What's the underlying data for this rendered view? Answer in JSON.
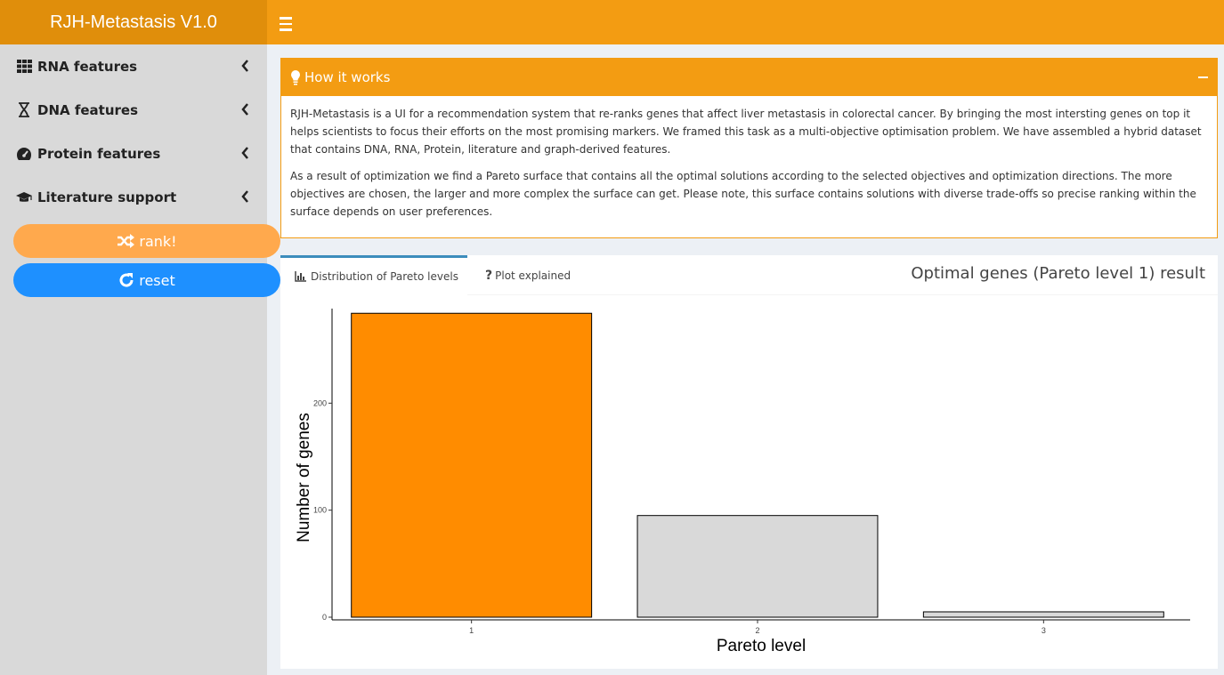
{
  "header": {
    "app_title": "RJH-Metastasis V1.0",
    "menu_icon": "hamburger-icon"
  },
  "sidebar": {
    "items": [
      {
        "label": "RNA features",
        "icon": "grid-icon"
      },
      {
        "label": "DNA features",
        "icon": "hourglass-icon"
      },
      {
        "label": "Protein features",
        "icon": "tachometer-icon"
      },
      {
        "label": "Literature support",
        "icon": "graduation-cap-icon"
      }
    ],
    "rank_label": "rank!",
    "reset_label": "reset"
  },
  "how_it_works": {
    "title": "How it works",
    "paragraph1": "RJH-Metastasis is a UI for a recommendation system that re-ranks genes that affect liver metastasis in colorectal cancer. By bringing the most intersting genes on top it helps scientists to focus their efforts on the most promising markers. We framed this task as a multi-objective optimisation problem. We have assembled a hybrid dataset that contains DNA, RNA, Protein, literature and graph-derived features.",
    "paragraph2": "As a result of optimization we find a Pareto surface that contains all the optimal solutions according to the selected objectives and optimization directions. The more objectives are chosen, the larger and more complex the surface can get. Please note, this surface contains solutions with diverse trade-offs so precise ranking within the surface depends on user preferences."
  },
  "results": {
    "tabs": [
      {
        "label": "Distribution of Pareto levels",
        "active": true
      },
      {
        "label": "Plot explained",
        "active": false
      }
    ],
    "title": "Optimal genes (Pareto level 1) result"
  },
  "chart_data": {
    "type": "bar",
    "categories": [
      "1",
      "2",
      "3"
    ],
    "values": [
      284,
      95,
      5
    ],
    "colors": [
      "#ff8c00",
      "#d9d9d9",
      "#d9d9d9"
    ],
    "xlabel": "Pareto level",
    "ylabel": "Number of genes",
    "yticks": [
      0,
      100,
      200
    ],
    "ylim": [
      0,
      300
    ],
    "grid": false
  },
  "colors": {
    "header": "#f39c12",
    "logo": "#e08e0b",
    "rank": "#ffa94d",
    "reset": "#1e90ff",
    "tab_accent": "#3c8dbc"
  }
}
